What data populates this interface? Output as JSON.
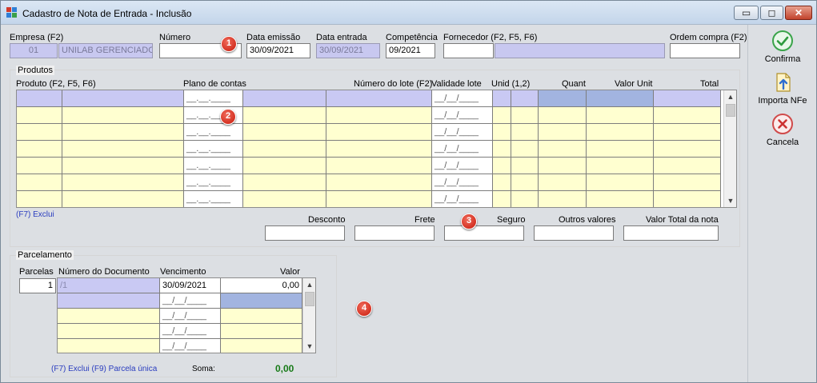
{
  "window": {
    "title": "Cadastro de Nota de Entrada - Inclusão"
  },
  "header": {
    "empresa_label": "Empresa (F2)",
    "empresa_code": "01",
    "empresa_name": "UNILAB GERENCIADOR",
    "numero_label": "Número",
    "numero_value": "",
    "data_emissao_label": "Data emissão",
    "data_emissao_value": "30/09/2021",
    "data_entrada_label": "Data entrada",
    "data_entrada_value": "30/09/2021",
    "competencia_label": "Competência",
    "competencia_value": "09/2021",
    "fornecedor_label": "Fornecedor (F2, F5, F6)",
    "fornecedor_code": "",
    "fornecedor_name": "",
    "ordem_compra_label": "Ordem compra (F2)",
    "ordem_compra_value": ""
  },
  "produtos": {
    "title": "Produtos",
    "columns": {
      "produto": "Produto (F2, F5, F6)",
      "plano": "Plano de contas",
      "lote": "Número do lote (F2)",
      "validade": "Validade lote",
      "unid": "Unid (1,2)",
      "quant": "Quant",
      "valor_unit": "Valor Unit",
      "total": "Total"
    },
    "plano_mask": "__.__.____",
    "validade_mask": "__/__/____",
    "exclui_hint": "(F7) Exclui"
  },
  "totais": {
    "desconto_label": "Desconto",
    "frete_label": "Frete",
    "seguro_label": "Seguro",
    "outros_label": "Outros valores",
    "valor_total_label": "Valor Total da nota"
  },
  "parcelamento": {
    "title": "Parcelamento",
    "parcelas_label": "Parcelas",
    "parcelas_value": "1",
    "num_doc_label": "Número do Documento",
    "vencimento_label": "Vencimento",
    "valor_label": "Valor",
    "row1": {
      "doc": "/1",
      "venc": "30/09/2021",
      "valor": "0,00"
    },
    "venc_mask": "__/__/____",
    "hint": "(F7) Exclui  (F9) Parcela única",
    "soma_label": "Soma:",
    "soma_value": "0,00"
  },
  "actions": {
    "confirma": "Confirma",
    "importa": "Importa NFe",
    "cancela": "Cancela"
  },
  "badges": [
    "1",
    "2",
    "3",
    "4"
  ],
  "window_buttons": {
    "minimize": "▭",
    "maximize": "◻",
    "close": "✕"
  }
}
